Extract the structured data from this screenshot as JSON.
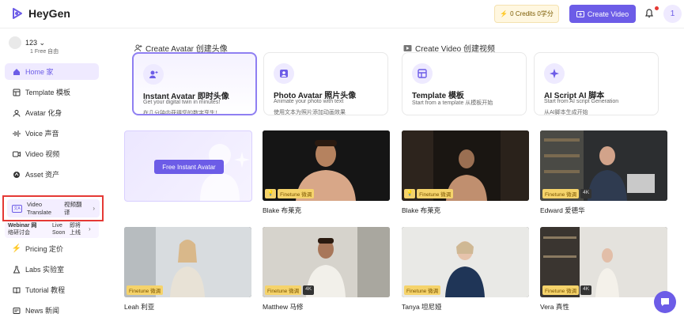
{
  "app": {
    "name": "HeyGen"
  },
  "topbar": {
    "credits": "0 Credits 0学分",
    "create_video": "Create Video",
    "avatar_initial": "1"
  },
  "user": {
    "name": "123 ⌄",
    "plan": "1  Free 自由"
  },
  "nav": [
    {
      "label": "Home 家",
      "icon": "home-icon"
    },
    {
      "label": "Template 模板",
      "icon": "template-icon"
    },
    {
      "label": "Avatar 化身",
      "icon": "avatar-icon"
    },
    {
      "label": "Voice 声音",
      "icon": "voice-icon"
    },
    {
      "label": "Video 视频",
      "icon": "video-icon"
    },
    {
      "label": "Asset 资产",
      "icon": "asset-icon"
    }
  ],
  "video_translate": {
    "label1": "Video",
    "label2": "Translate",
    "label_cn1": "视频翻",
    "label_cn2": "译"
  },
  "webinar": {
    "l1": "Webinar 网",
    "l2": "络研讨会",
    "s1": "Live",
    "s2": "Soon",
    "c1": "即将",
    "c2": "上线"
  },
  "nav2": [
    {
      "label": "Pricing 定价",
      "icon": "pricing-icon"
    },
    {
      "label": "Labs 实验室",
      "icon": "labs-icon"
    },
    {
      "label": "Tutorial 教程",
      "icon": "tutorial-icon"
    },
    {
      "label": "News 新闻",
      "icon": "news-icon"
    }
  ],
  "sections": {
    "avatar": "Create Avatar 创建头像",
    "video": "Create Video 创建视频"
  },
  "cards": [
    {
      "title": "Instant Avatar 即时头像",
      "sub": "Get your digital twin in minutes!",
      "sub2": "在几分钟内获得您的数字孪生！"
    },
    {
      "title": "Photo Avatar 照片头像",
      "sub": "Animate your photo with text",
      "sub2": "使用文本为照片添加动画效果"
    },
    {
      "title": "Template 模板",
      "sub": "Start from a template 从模板开始",
      "sub2": ""
    },
    {
      "title": "AI Script AI 脚本",
      "sub": "Start from AI script Generation",
      "sub2": "从AI脚本生成开始"
    }
  ],
  "free_tile": {
    "button": "Free Instant Avatar"
  },
  "tiles": [
    {
      "name": "Blake 布莱克",
      "badge": "Finetune 微调",
      "k4": ""
    },
    {
      "name": "Blake 布莱克",
      "badge": "Finetune 微调",
      "k4": ""
    },
    {
      "name": "Edward 爱德华",
      "badge": "Finetune 微调",
      "k4": "4K"
    },
    {
      "name": "Leah 利亚",
      "badge": "Finetune 微调",
      "k4": ""
    },
    {
      "name": "Matthew 马修",
      "badge": "Finetune 微调",
      "k4": "4K"
    },
    {
      "name": "Tanya 坦尼娅",
      "badge": "Finetune 微调",
      "k4": ""
    },
    {
      "name": "Vera 真性",
      "badge": "Finetune 微调",
      "k4": "4K"
    }
  ],
  "colors": {
    "accent": "#6c5ce7",
    "highlight": "#e53935"
  }
}
